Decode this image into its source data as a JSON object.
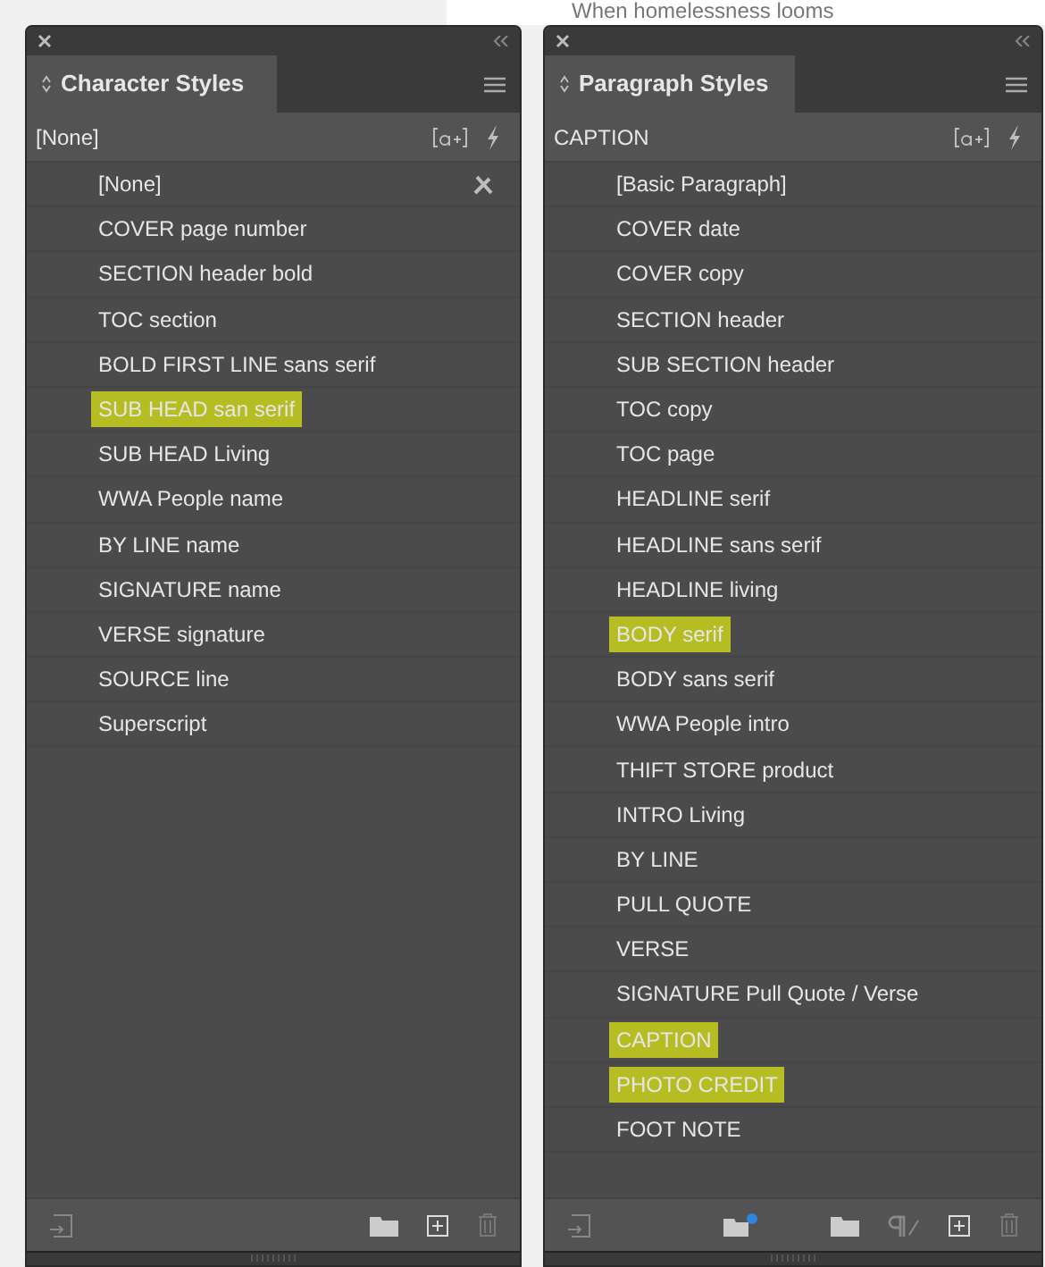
{
  "background_text": "When homelessness looms",
  "panels": [
    {
      "tab": "Character Styles",
      "current": "[None]",
      "items": [
        {
          "label": "[None]",
          "highlighted": false,
          "locked": true
        },
        {
          "label": "COVER page number",
          "highlighted": false,
          "locked": false
        },
        {
          "label": "SECTION header bold",
          "highlighted": false,
          "locked": false
        },
        {
          "label": "TOC section",
          "highlighted": false,
          "locked": false
        },
        {
          "label": "BOLD FIRST LINE sans serif",
          "highlighted": false,
          "locked": false
        },
        {
          "label": "SUB HEAD san serif",
          "highlighted": true,
          "locked": false
        },
        {
          "label": "SUB HEAD Living",
          "highlighted": false,
          "locked": false
        },
        {
          "label": "WWA People name",
          "highlighted": false,
          "locked": false
        },
        {
          "label": "BY LINE name",
          "highlighted": false,
          "locked": false
        },
        {
          "label": "SIGNATURE name",
          "highlighted": false,
          "locked": false
        },
        {
          "label": "VERSE signature",
          "highlighted": false,
          "locked": false
        },
        {
          "label": "SOURCE line",
          "highlighted": false,
          "locked": false
        },
        {
          "label": "Superscript",
          "highlighted": false,
          "locked": false
        }
      ],
      "paragraph_tools": false
    },
    {
      "tab": "Paragraph Styles",
      "current": "CAPTION",
      "items": [
        {
          "label": "[Basic Paragraph]",
          "highlighted": false,
          "locked": false
        },
        {
          "label": "COVER date",
          "highlighted": false,
          "locked": false
        },
        {
          "label": "COVER copy",
          "highlighted": false,
          "locked": false
        },
        {
          "label": "SECTION header",
          "highlighted": false,
          "locked": false
        },
        {
          "label": "SUB SECTION header",
          "highlighted": false,
          "locked": false
        },
        {
          "label": "TOC copy",
          "highlighted": false,
          "locked": false
        },
        {
          "label": "TOC page",
          "highlighted": false,
          "locked": false
        },
        {
          "label": "HEADLINE serif",
          "highlighted": false,
          "locked": false
        },
        {
          "label": "HEADLINE sans serif",
          "highlighted": false,
          "locked": false
        },
        {
          "label": "HEADLINE living",
          "highlighted": false,
          "locked": false
        },
        {
          "label": "BODY serif",
          "highlighted": true,
          "locked": false
        },
        {
          "label": "BODY sans serif",
          "highlighted": false,
          "locked": false
        },
        {
          "label": "WWA People intro",
          "highlighted": false,
          "locked": false
        },
        {
          "label": "THIFT STORE product",
          "highlighted": false,
          "locked": false
        },
        {
          "label": "INTRO Living",
          "highlighted": false,
          "locked": false
        },
        {
          "label": "BY LINE",
          "highlighted": false,
          "locked": false
        },
        {
          "label": "PULL QUOTE",
          "highlighted": false,
          "locked": false
        },
        {
          "label": "VERSE",
          "highlighted": false,
          "locked": false
        },
        {
          "label": "SIGNATURE Pull Quote / Verse",
          "highlighted": false,
          "locked": false
        },
        {
          "label": "CAPTION",
          "highlighted": true,
          "locked": false
        },
        {
          "label": "PHOTO CREDIT",
          "highlighted": true,
          "locked": false
        },
        {
          "label": "FOOT NOTE",
          "highlighted": false,
          "locked": false
        }
      ],
      "paragraph_tools": true
    }
  ]
}
